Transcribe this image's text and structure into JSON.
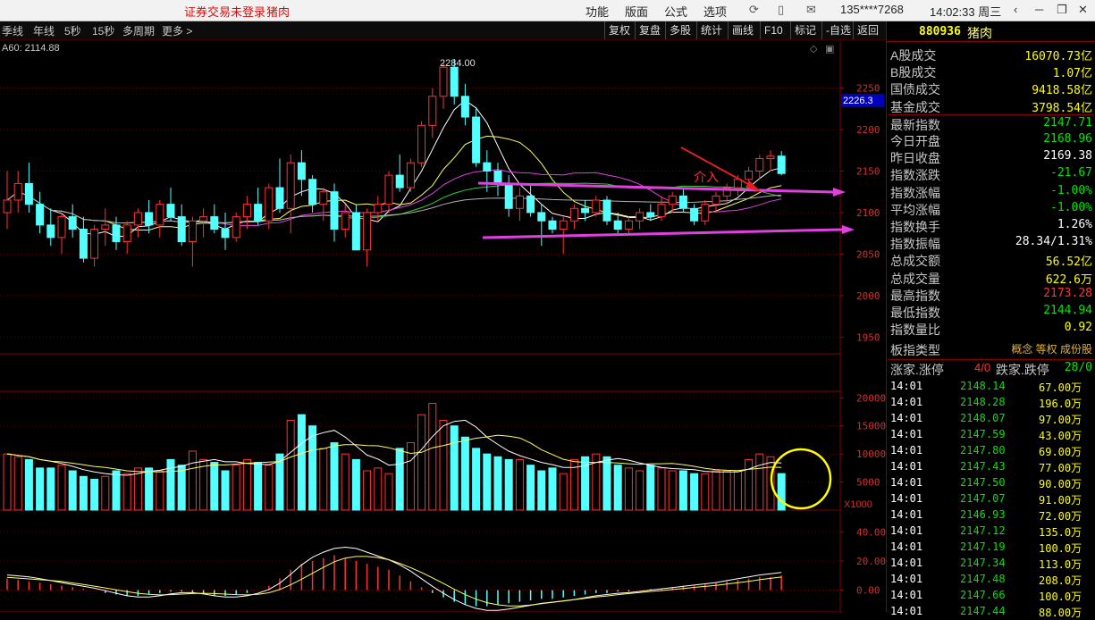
{
  "titlebar": {
    "login_status": "证券交易未登录",
    "stock_name": "猪肉",
    "menus": [
      "功能",
      "版面",
      "公式",
      "选项"
    ],
    "account": "135****7268",
    "clock": "14:02:33 周三"
  },
  "toolbar": {
    "periods": [
      "季线",
      "年线",
      "5秒",
      "15秒",
      "多周期",
      "更多 >"
    ],
    "buttons": [
      "复权",
      "复盘",
      "多股",
      "统计",
      "画线",
      "F10",
      "标记",
      "-自选",
      "返回"
    ]
  },
  "chart_data": [
    {
      "type": "candlestick",
      "panel": "price",
      "ma_label": "A60: 2114.88",
      "high_annotation": "2284.00",
      "current_price_tag": "2226.3",
      "annotation_text": "介入",
      "y_ticks": [
        2250,
        2200,
        2150,
        2100,
        2050,
        2000,
        1950
      ],
      "ylim": [
        1930,
        2300
      ],
      "ohlc": [
        [
          2100,
          2150,
          2080,
          2115
        ],
        [
          2115,
          2150,
          2100,
          2135
        ],
        [
          2135,
          2160,
          2100,
          2110
        ],
        [
          2110,
          2125,
          2075,
          2085
        ],
        [
          2085,
          2105,
          2060,
          2070
        ],
        [
          2070,
          2100,
          2050,
          2095
        ],
        [
          2095,
          2110,
          2070,
          2080
        ],
        [
          2080,
          2095,
          2040,
          2045
        ],
        [
          2045,
          2085,
          2035,
          2080
        ],
        [
          2080,
          2105,
          2060,
          2085
        ],
        [
          2085,
          2095,
          2055,
          2065
        ],
        [
          2065,
          2090,
          2050,
          2085
        ],
        [
          2085,
          2105,
          2070,
          2100
        ],
        [
          2100,
          2115,
          2075,
          2085
        ],
        [
          2085,
          2115,
          2070,
          2110
        ],
        [
          2110,
          2130,
          2090,
          2095
        ],
        [
          2095,
          2110,
          2060,
          2065
        ],
        [
          2065,
          2095,
          2035,
          2090
        ],
        [
          2090,
          2105,
          2070,
          2095
        ],
        [
          2095,
          2110,
          2075,
          2080
        ],
        [
          2080,
          2100,
          2055,
          2070
        ],
        [
          2070,
          2100,
          2065,
          2095
        ],
        [
          2095,
          2120,
          2080,
          2110
        ],
        [
          2110,
          2130,
          2085,
          2090
        ],
        [
          2090,
          2135,
          2080,
          2130
        ],
        [
          2130,
          2165,
          2100,
          2105
        ],
        [
          2105,
          2170,
          2075,
          2160
        ],
        [
          2160,
          2175,
          2120,
          2140
        ],
        [
          2140,
          2145,
          2100,
          2110
        ],
        [
          2110,
          2130,
          2090,
          2125
        ],
        [
          2125,
          2135,
          2065,
          2080
        ],
        [
          2080,
          2110,
          2070,
          2100
        ],
        [
          2100,
          2110,
          2055,
          2055
        ],
        [
          2055,
          2105,
          2035,
          2100
        ],
        [
          2100,
          2120,
          2090,
          2110
        ],
        [
          2110,
          2150,
          2100,
          2145
        ],
        [
          2145,
          2170,
          2125,
          2130
        ],
        [
          2130,
          2165,
          2125,
          2160
        ],
        [
          2160,
          2210,
          2155,
          2205
        ],
        [
          2205,
          2250,
          2190,
          2240
        ],
        [
          2240,
          2280,
          2225,
          2275
        ],
        [
          2275,
          2285,
          2230,
          2240
        ],
        [
          2240,
          2255,
          2205,
          2215
        ],
        [
          2215,
          2225,
          2155,
          2160
        ],
        [
          2160,
          2175,
          2125,
          2150
        ],
        [
          2150,
          2160,
          2120,
          2135
        ],
        [
          2135,
          2145,
          2095,
          2105
        ],
        [
          2105,
          2130,
          2090,
          2120
        ],
        [
          2120,
          2135,
          2095,
          2100
        ],
        [
          2100,
          2110,
          2060,
          2090
        ],
        [
          2090,
          2095,
          2075,
          2080
        ],
        [
          2080,
          2095,
          2050,
          2090
        ],
        [
          2090,
          2110,
          2080,
          2105
        ],
        [
          2105,
          2115,
          2090,
          2100
        ],
        [
          2100,
          2120,
          2095,
          2115
        ],
        [
          2115,
          2120,
          2085,
          2090
        ],
        [
          2090,
          2100,
          2075,
          2080
        ],
        [
          2080,
          2095,
          2075,
          2090
        ],
        [
          2090,
          2105,
          2080,
          2100
        ],
        [
          2100,
          2110,
          2090,
          2095
        ],
        [
          2095,
          2120,
          2090,
          2110
        ],
        [
          2110,
          2125,
          2100,
          2120
        ],
        [
          2120,
          2130,
          2100,
          2105
        ],
        [
          2105,
          2110,
          2085,
          2090
        ],
        [
          2090,
          2115,
          2085,
          2110
        ],
        [
          2110,
          2125,
          2100,
          2120
        ],
        [
          2120,
          2135,
          2110,
          2130
        ],
        [
          2130,
          2145,
          2120,
          2140
        ],
        [
          2140,
          2155,
          2135,
          2150
        ],
        [
          2150,
          2170,
          2140,
          2165
        ],
        [
          2165,
          2175,
          2150,
          2168
        ],
        [
          2168,
          2174,
          2145,
          2147
        ]
      ]
    },
    {
      "type": "bar",
      "panel": "volume",
      "unit_label": "X1000",
      "y_ticks": [
        20000,
        15000,
        10000,
        5000
      ],
      "ylim": [
        0,
        21000
      ],
      "values": [
        10000,
        9500,
        9000,
        7500,
        7500,
        8000,
        7000,
        6000,
        5500,
        6000,
        7000,
        6500,
        7500,
        7500,
        7000,
        9000,
        8000,
        10500,
        9000,
        8500,
        7000,
        8000,
        9000,
        8500,
        8000,
        10000,
        16000,
        17000,
        15000,
        11000,
        12000,
        10000,
        9000,
        7000,
        7500,
        6500,
        11000,
        12000,
        17000,
        19000,
        16000,
        15000,
        13000,
        11000,
        10000,
        9500,
        9000,
        9000,
        8000,
        7000,
        7500,
        6500,
        9000,
        9500,
        10000,
        9500,
        8000,
        7500,
        7000,
        8000,
        7500,
        7000,
        7000,
        6500,
        6500,
        7000,
        7000,
        7000,
        9000,
        10000,
        9500,
        6500
      ],
      "up": [
        true,
        true,
        false,
        false,
        false,
        true,
        false,
        false,
        false,
        true,
        false,
        true,
        true,
        false,
        true,
        false,
        false,
        true,
        true,
        false,
        false,
        true,
        true,
        false,
        true,
        false,
        true,
        false,
        false,
        true,
        false,
        true,
        false,
        true,
        true,
        true,
        false,
        true,
        true,
        true,
        true,
        false,
        false,
        false,
        false,
        false,
        false,
        true,
        false,
        false,
        false,
        true,
        true,
        false,
        true,
        false,
        false,
        true,
        true,
        false,
        true,
        true,
        false,
        false,
        true,
        true,
        true,
        true,
        true,
        true,
        true,
        false
      ]
    },
    {
      "type": "histogram",
      "panel": "macd",
      "y_ticks": [
        40.0,
        20.0,
        0.0
      ],
      "ylim": [
        -15,
        50
      ],
      "values": [
        8,
        7,
        6,
        5,
        4,
        3,
        2,
        1,
        0,
        -2,
        -3,
        -4,
        -4,
        -3,
        -2,
        -1,
        -1,
        -2,
        -3,
        -4,
        -4,
        -3,
        -2,
        0,
        3,
        8,
        14,
        18,
        20,
        22,
        24,
        22,
        20,
        18,
        16,
        14,
        10,
        6,
        2,
        -2,
        -5,
        -8,
        -10,
        -11,
        -11,
        -10,
        -9,
        -8,
        -7,
        -6,
        -6,
        -5,
        -4,
        -3,
        -2,
        -2,
        -1,
        -1,
        0,
        1,
        1,
        2,
        3,
        3,
        4,
        5,
        6,
        7,
        8,
        9,
        9,
        10
      ]
    }
  ],
  "side_panel": {
    "code": "880936",
    "name": "猪肉",
    "stats": [
      {
        "label": "A股成交",
        "value": "16070.73亿",
        "color": "#ffff00"
      },
      {
        "label": "B股成交",
        "value": "1.07亿",
        "color": "#ffff00"
      },
      {
        "label": "国债成交",
        "value": "9418.58亿",
        "color": "#ffff00"
      },
      {
        "label": "基金成交",
        "value": "3798.54亿",
        "color": "#ffff00"
      },
      {
        "label": "最新指数",
        "value": "2147.71",
        "color": "#00e600"
      },
      {
        "label": "今日开盘",
        "value": "2168.96",
        "color": "#00e600"
      },
      {
        "label": "昨日收盘",
        "value": "2169.38",
        "color": "#ffffff"
      },
      {
        "label": "指数涨跌",
        "value": "-21.67",
        "color": "#00e600"
      },
      {
        "label": "指数涨幅",
        "value": "-1.00%",
        "color": "#00e600"
      },
      {
        "label": "平均涨幅",
        "value": "-1.00%",
        "color": "#00e600"
      },
      {
        "label": "指数换手",
        "value": "1.26%",
        "color": "#ffffff"
      },
      {
        "label": "指数振幅",
        "value": "28.34/1.31%",
        "color": "#ffffff"
      },
      {
        "label": "总成交额",
        "value": "56.52亿",
        "color": "#ffff00"
      },
      {
        "label": "总成交量",
        "value": "622.6万",
        "color": "#ffff00"
      },
      {
        "label": "最高指数",
        "value": "2173.28",
        "color": "#ff3232"
      },
      {
        "label": "最低指数",
        "value": "2144.94",
        "color": "#00e600"
      },
      {
        "label": "指数量比",
        "value": "0.92",
        "color": "#ffff00"
      }
    ],
    "index_type_label": "板指类型",
    "index_type_value": "概念 等权 成份股",
    "rise_label": "涨家.涨停",
    "rise_value": "4/0",
    "fall_label": "跌家.跌停",
    "fall_value": "28/0",
    "ticks": [
      [
        "14:01",
        "2148.14",
        "67.00万"
      ],
      [
        "14:01",
        "2148.28",
        "196.0万"
      ],
      [
        "14:01",
        "2148.07",
        "97.00万"
      ],
      [
        "14:01",
        "2147.59",
        "43.00万"
      ],
      [
        "14:01",
        "2147.80",
        "69.00万"
      ],
      [
        "14:01",
        "2147.43",
        "77.00万"
      ],
      [
        "14:01",
        "2147.50",
        "90.00万"
      ],
      [
        "14:01",
        "2147.07",
        "91.00万"
      ],
      [
        "14:01",
        "2146.93",
        "72.00万"
      ],
      [
        "14:01",
        "2147.12",
        "135.0万"
      ],
      [
        "14:01",
        "2147.19",
        "100.0万"
      ],
      [
        "14:01",
        "2147.34",
        "113.0万"
      ],
      [
        "14:01",
        "2147.48",
        "208.0万"
      ],
      [
        "14:01",
        "2147.66",
        "100.0万"
      ],
      [
        "14:01",
        "2147.44",
        "88.00万"
      ]
    ]
  }
}
